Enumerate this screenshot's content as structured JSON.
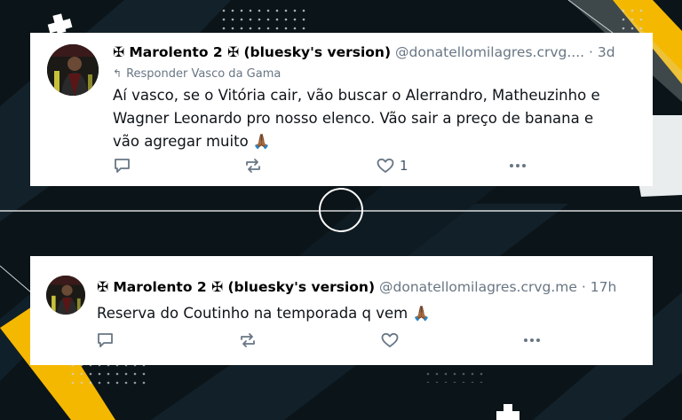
{
  "posts": [
    {
      "display_name": "✠ Marolento 2 ✠ (bluesky's version)",
      "handle": "@donatellomilagres.crvg....",
      "separator": "·",
      "time": "3d",
      "reply_to": "Responder Vasco da Gama",
      "text": "Aí vasco, se o Vitória cair, vão buscar o Alerrandro, Matheuzinho e\nWagner Leonardo pro nosso elenco. Vão sair a preço de banana e\nvão agregar muito",
      "emoji": "🙏🏾",
      "like_count": "1",
      "icons": [
        "reply-icon",
        "repost-icon",
        "like-icon",
        "more-icon"
      ]
    },
    {
      "display_name": "✠ Marolento 2 ✠ (bluesky's version)",
      "handle": "@donatellomilagres.crvg.me",
      "separator": "·",
      "time": "17h",
      "text": "Reserva do Coutinho na temporada q vem",
      "emoji": "🙏🏾",
      "icons": [
        "reply-icon",
        "repost-icon",
        "like-icon",
        "more-icon"
      ]
    }
  ],
  "colors": {
    "background": "#0b1418",
    "accent_yellow": "#f5b800",
    "muted_text": "#687684",
    "card": "#ffffff"
  }
}
